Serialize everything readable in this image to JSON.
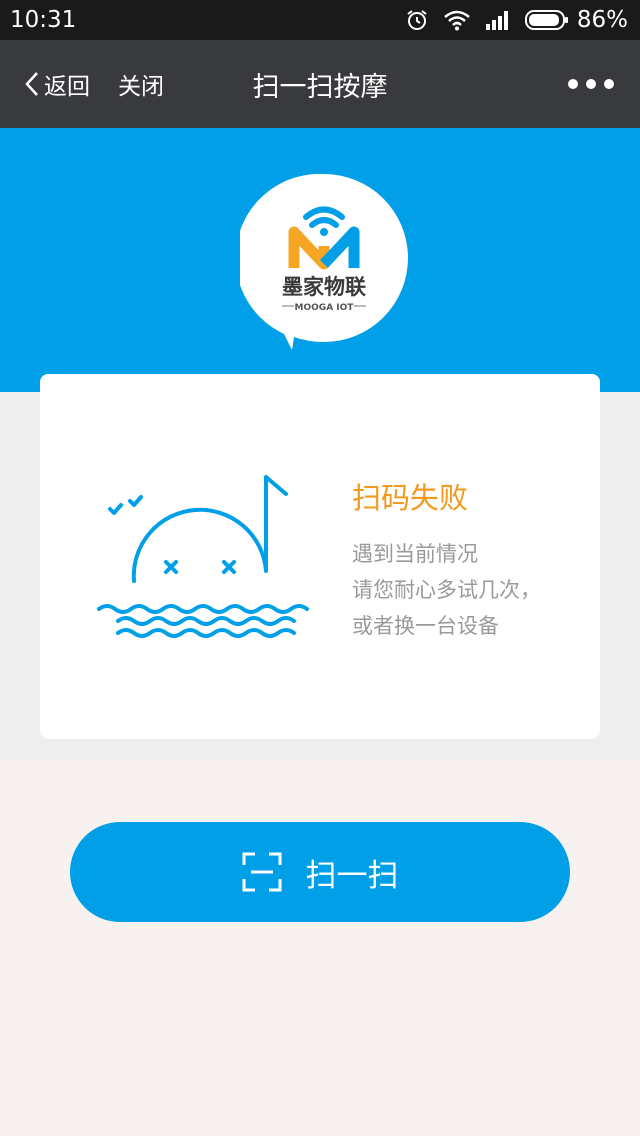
{
  "status_bar": {
    "time": "10:31",
    "battery": "86%",
    "icons": [
      "alarm-icon",
      "wifi-icon",
      "signal-icon",
      "battery-icon"
    ]
  },
  "nav": {
    "back_label": "返回",
    "close_label": "关闭",
    "title": "扫一扫按摩",
    "more_icon": "more-dots-icon"
  },
  "logo": {
    "brand_cn": "墨家物联",
    "brand_en": "MOOGA IOT"
  },
  "result": {
    "title": "扫码失败",
    "message_lines": [
      "遇到当前情况",
      "请您耐心多试几次，",
      "或者换一台设备"
    ]
  },
  "scan_button": {
    "label": "扫一扫",
    "icon": "scan-frame-icon"
  },
  "colors": {
    "accent_blue": "#009fe8",
    "nav_bg": "#393a3e",
    "status_bg": "#1a1a1a",
    "fail_orange": "#f39a1d",
    "logo_orange": "#f5a623"
  }
}
